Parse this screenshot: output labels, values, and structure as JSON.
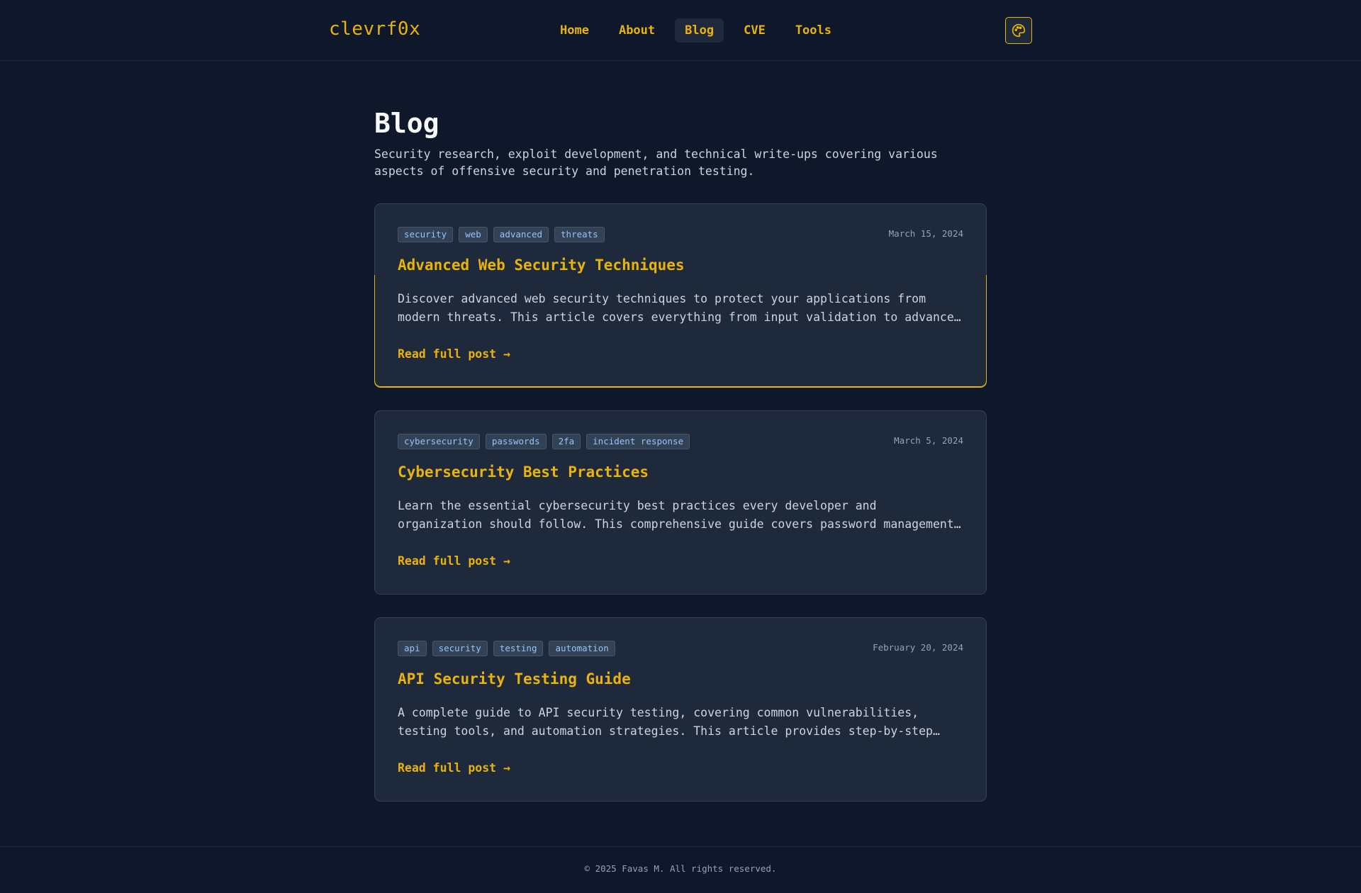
{
  "header": {
    "logo": "clevrf0x",
    "nav": [
      {
        "label": "Home"
      },
      {
        "label": "About"
      },
      {
        "label": "Blog"
      },
      {
        "label": "CVE"
      },
      {
        "label": "Tools"
      }
    ],
    "theme_icon": "palette-icon"
  },
  "page": {
    "title": "Blog",
    "description": "Security research, exploit development, and technical write-ups covering various aspects of offensive security and penetration testing."
  },
  "posts": [
    {
      "tags": [
        "security",
        "web",
        "advanced",
        "threats"
      ],
      "date": "March 15, 2024",
      "title": "Advanced Web Security Techniques",
      "excerpt": "Discover advanced web security techniques to protect your applications from modern threats. This article covers everything from input validation to advanced threat detection.",
      "link": "Read full post →"
    },
    {
      "tags": [
        "cybersecurity",
        "passwords",
        "2fa",
        "incident response"
      ],
      "date": "March 5, 2024",
      "title": "Cybersecurity Best Practices",
      "excerpt": "Learn the essential cybersecurity best practices every developer and organization should follow. This comprehensive guide covers password management, software updates, and more.",
      "link": "Read full post →"
    },
    {
      "tags": [
        "api",
        "security",
        "testing",
        "automation"
      ],
      "date": "February 20, 2024",
      "title": "API Security Testing Guide",
      "excerpt": "A complete guide to API security testing, covering common vulnerabilities, testing tools, and automation strategies. This article provides step-by-step instructions for testing.",
      "link": "Read full post →"
    }
  ],
  "footer": {
    "text": "© 2025 Favas M. All rights reserved."
  },
  "colors": {
    "background": "#0f172a",
    "card": "#1e293b",
    "accent": "#eab308",
    "tag_text": "#93c5fd"
  }
}
